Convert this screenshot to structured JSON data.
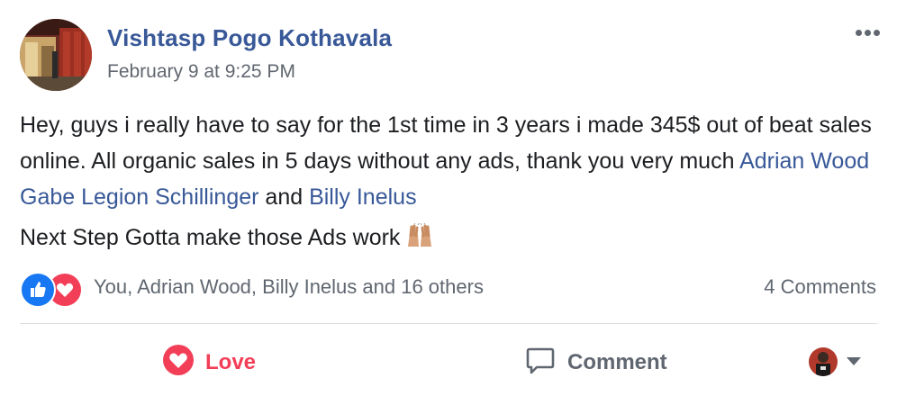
{
  "post": {
    "author": "Vishtasp Pogo Kothavala",
    "timestamp": "February 9 at 9:25 PM",
    "more_icon": "ellipsis-icon",
    "body": {
      "p1_part1": "Hey, guys i really have to say for the 1st time in 3 years i made 345$ out of beat sales online. All organic sales in 5 days without any ads, thank you very much ",
      "mention1": "Adrian Wood",
      "mention2": "Gabe Legion Schillinger",
      "p1_and": " and ",
      "mention3": "Billy Inelus",
      "p2": "Next Step Gotta make those Ads work",
      "emoji": "raising-hands-emoji"
    }
  },
  "reactions": {
    "icons": [
      "like-icon",
      "love-icon"
    ],
    "summary": "You, Adrian Wood, Billy Inelus and 16 others",
    "comments": "4 Comments"
  },
  "actions": {
    "love_label": "Love",
    "comment_label": "Comment"
  },
  "colors": {
    "link": "#385898",
    "love": "#f33e58",
    "like": "#1877f2",
    "muted": "#606770"
  }
}
